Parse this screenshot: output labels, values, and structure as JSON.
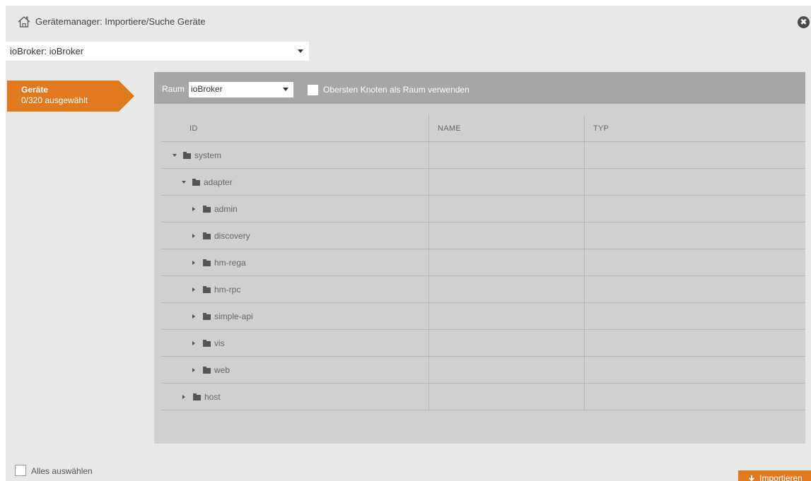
{
  "window": {
    "title": "Gerätemanager: Importiere/Suche Geräte",
    "title_icon": "home-icon",
    "close_icon": "close-icon",
    "close_glyph": "✖"
  },
  "instance_select": {
    "value": "ioBroker: ioBroker"
  },
  "sidebar": {
    "tab_title": "Geräte",
    "tab_subtitle": "0/320 ausgewählt"
  },
  "toolbar": {
    "raum_label": "Raum",
    "raum_value": "ioBroker",
    "top_node_checkbox_label": "Obersten Knoten als Raum verwenden"
  },
  "table": {
    "headers": {
      "id": "ID",
      "name": "NAME",
      "typ": "TYP"
    },
    "rows": [
      {
        "label": "system",
        "expanded": true,
        "depth": 0
      },
      {
        "label": "adapter",
        "expanded": true,
        "depth": 1
      },
      {
        "label": "admin",
        "expanded": false,
        "depth": 2
      },
      {
        "label": "discovery",
        "expanded": false,
        "depth": 2
      },
      {
        "label": "hm-rega",
        "expanded": false,
        "depth": 2
      },
      {
        "label": "hm-rpc",
        "expanded": false,
        "depth": 2
      },
      {
        "label": "simple-api",
        "expanded": false,
        "depth": 2
      },
      {
        "label": "vis",
        "expanded": false,
        "depth": 2
      },
      {
        "label": "web",
        "expanded": false,
        "depth": 2
      },
      {
        "label": "host",
        "expanded": false,
        "depth": 1
      }
    ]
  },
  "footer": {
    "select_all_label": "Alles auswählen",
    "import_label": "Importieren",
    "import_icon": "download-icon"
  },
  "colors": {
    "accent": "#e07a20",
    "toolbar_bg": "#a6a6a6",
    "panel_bg": "#d0d0d0",
    "dialog_bg": "#e8e8e8"
  }
}
